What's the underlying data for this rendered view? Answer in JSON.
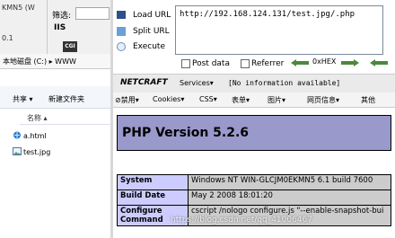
{
  "background_window": {
    "text_top": "KMN5 (W",
    "text_mid": "0.1",
    "filter_label": "筛选:",
    "iis_label": "IIS",
    "cgi_label": "CGI"
  },
  "explorer": {
    "address": "本地磁盘 (C:) ▸ WWW",
    "toolbar": {
      "share": "共享 ▾",
      "new_folder": "新建文件夹"
    },
    "column_name": "名称 ▴",
    "files": [
      {
        "name": "a.html",
        "icon": "html-file-icon"
      },
      {
        "name": "test.jpg",
        "icon": "image-file-icon"
      }
    ]
  },
  "hackbar": {
    "load_url": "Load URL",
    "split_url": "Split URL",
    "execute": "Execute",
    "url_value": "http://192.168.124.131/test.jpg/.php",
    "post_data": "Post data",
    "referrer": "Referrer",
    "hex_label": "0xHEX"
  },
  "netcraft": {
    "brand": "NETCRAFT",
    "services": "Services▾",
    "info": "[No information available]"
  },
  "extension_bar": {
    "items": [
      "⊘禁用▾",
      "Cookies▾",
      "CSS▾",
      "表单▾",
      "图片▾",
      "网页信息▾",
      "其他"
    ]
  },
  "php": {
    "title": "PHP Version 5.2.6",
    "rows": [
      {
        "key": "System",
        "value": "Windows NT WIN-GLCJM0EKMN5 6.1 build 7600"
      },
      {
        "key": "Build Date",
        "value": "May 2 2008 18:01:20"
      },
      {
        "key": "Configure Command",
        "value": "cscript /nologo configure.js \"--enable-snapshot-bui"
      }
    ]
  },
  "watermark": "https://blog.csdn.net/qq_41006467",
  "colors": {
    "php_header": "#9999cc",
    "php_key": "#ccccff",
    "php_value": "#cccccc"
  }
}
